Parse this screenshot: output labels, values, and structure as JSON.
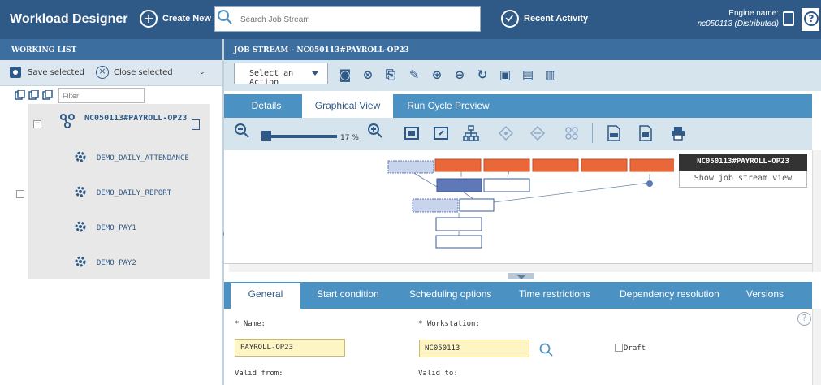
{
  "header": {
    "app_title": "Workload Designer",
    "create_new": "Create New",
    "search_placeholder": "Search Job Stream",
    "recent_activity": "Recent Activity",
    "engine_label": "Engine name:",
    "engine_value": "nc050113 (Distributed)"
  },
  "working_list": {
    "title": "WORKING LIST",
    "save_selected": "Save selected",
    "close_selected": "Close selected",
    "filter_placeholder": "Filter",
    "job_stream": "NC050113#PAYROLL-OP23",
    "jobs": [
      "DEMO_DAILY_ATTENDANCE",
      "DEMO_DAILY_REPORT",
      "DEMO_PAY1",
      "DEMO_PAY2"
    ]
  },
  "job_stream_panel": {
    "title": "JOB STREAM - NC050113#PAYROLL-OP23",
    "action_select": "Select an Action",
    "tabs": [
      "Details",
      "Graphical View",
      "Run Cycle Preview"
    ],
    "zoom_percent": "17 %",
    "zoom_level": 0.17,
    "popup_title": "NC050113#PAYROLL-OP23",
    "popup_link": "Show job stream view"
  },
  "properties": {
    "tabs": [
      "General",
      "Start condition",
      "Scheduling options",
      "Time restrictions",
      "Dependency resolution",
      "Versions"
    ],
    "name_label": "* Name:",
    "name_value": "PAYROLL-OP23",
    "workstation_label": "* Workstation:",
    "workstation_value": "NC050113",
    "draft_label": "Draft",
    "valid_from_label": "Valid from:",
    "valid_to_label": "Valid to:"
  },
  "colors": {
    "topbar": "#2f5a87",
    "header": "#3d6ea0",
    "tabs": "#4b91c2",
    "accent": "#2f5a87",
    "node_orange": "#e8683a",
    "input_yellow": "#fdf5c4"
  }
}
